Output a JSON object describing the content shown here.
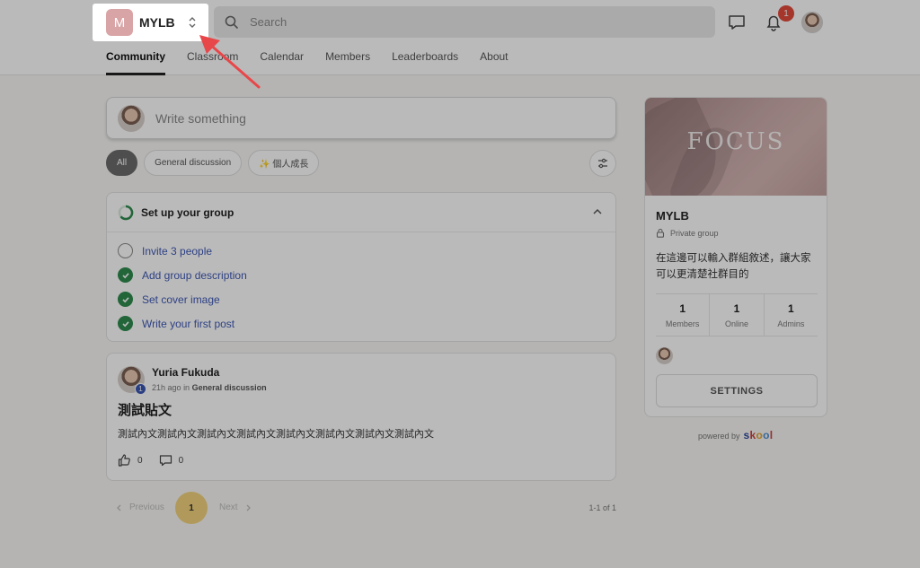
{
  "group": {
    "initial": "M",
    "name": "MYLB"
  },
  "search": {
    "placeholder": "Search"
  },
  "notifications": {
    "count": "1"
  },
  "tabs": [
    "Community",
    "Classroom",
    "Calendar",
    "Members",
    "Leaderboards",
    "About"
  ],
  "composer": {
    "placeholder": "Write something"
  },
  "filters": [
    "All",
    "General discussion",
    "✨ 個人成長"
  ],
  "setup": {
    "title": "Set up your group",
    "items": [
      {
        "label": "Invite 3 people",
        "done": false
      },
      {
        "label": "Add group description",
        "done": true
      },
      {
        "label": "Set cover image",
        "done": true
      },
      {
        "label": "Write your first post",
        "done": true
      }
    ]
  },
  "post": {
    "author": "Yuria Fukuda",
    "level": "1",
    "time": "21h ago",
    "in_word": "in",
    "category": "General discussion",
    "title": "測試貼文",
    "body": "測試內文測試內文測試內文測試內文測試內文測試內文測試內文測試內文",
    "likes": "0",
    "comments": "0"
  },
  "pagination": {
    "prev": "Previous",
    "current": "1",
    "next": "Next",
    "range": "1-1 of 1"
  },
  "sidebar": {
    "cover_text": "FOCUS",
    "name": "MYLB",
    "privacy": "Private group",
    "description": "在這邊可以輸入群組敘述，讓大家可以更清楚社群目的",
    "stats": [
      {
        "num": "1",
        "label": "Members"
      },
      {
        "num": "1",
        "label": "Online"
      },
      {
        "num": "1",
        "label": "Admins"
      }
    ],
    "settings_label": "SETTINGS"
  },
  "powered": {
    "text": "powered by",
    "brand": "skool"
  },
  "colors": {
    "accent_arrow": "#e8474a",
    "check_green": "#2e8b4e",
    "link_blue": "#3f59b5"
  }
}
